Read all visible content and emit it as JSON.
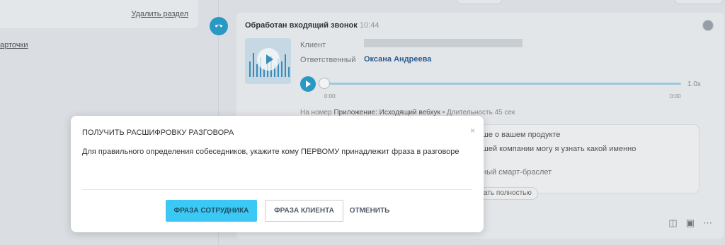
{
  "left": {
    "delete_section": "Удалить раздел",
    "cards_link": "арточки"
  },
  "call": {
    "title": "Обработан входящий звонок",
    "time": "10:44",
    "client_label": "Клиент",
    "responsible_label": "Ответственный",
    "responsible_value": "Оксана Андреева",
    "player": {
      "progress": 0,
      "speed": "1.0x",
      "current_time": "0:00",
      "total_time": "0:00"
    },
    "meta": {
      "prefix": "На номер",
      "number": "Приложение: Исходящий вебхук",
      "duration": "• Длительность 45 сек"
    },
    "transcript": {
      "line1": "ше о вашем продукте",
      "line2": "шей компании могу я узнать какой именно",
      "line3": "ный смарт-браслет"
    },
    "show_all": "ать полностью"
  },
  "modal": {
    "title": "ПОЛУЧИТЬ РАСШИФРОВКУ РАЗГОВОРА",
    "close": "×",
    "text": "Для правильного определения собеседников, укажите кому ПЕРВОМУ принадлежит фраза в разговоре",
    "btn_employee": "ФРАЗА СОТРУДНИКА",
    "btn_client": "ФРАЗА КЛИЕНТА",
    "btn_cancel": "ОТМЕНИТЬ"
  },
  "colors": {
    "accent": "#3bc8f5",
    "call_icon": "#2a9cc9",
    "link_name": "#2b5f92"
  }
}
